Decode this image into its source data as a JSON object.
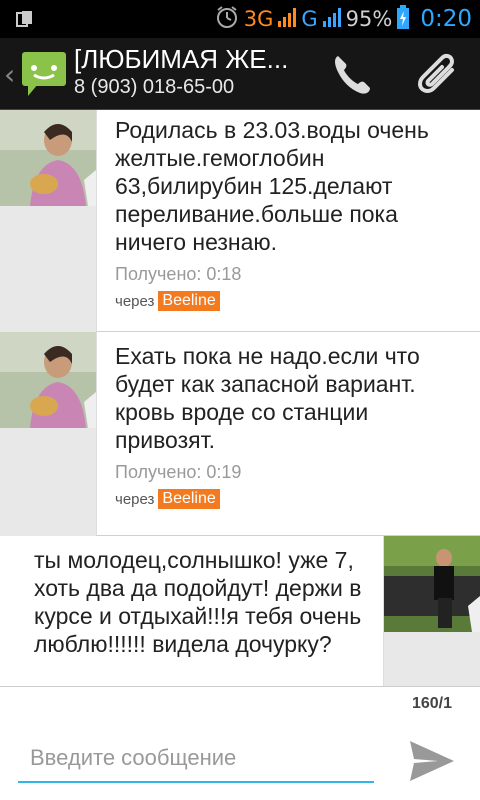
{
  "status_bar": {
    "network_3g": "3G",
    "network_g": "G",
    "battery_pct": "95%",
    "time": "0:20"
  },
  "action_bar": {
    "title": "[ЛЮБИМАЯ ЖЕ...",
    "subtitle": "8 (903) 018-65-00"
  },
  "messages": [
    {
      "direction": "incoming",
      "text": "Родилась в 23.03.воды очень желтые.гемоглобин 63,билирубин 125.делают переливание.больше пока ничего незнаю.",
      "status": "Получено: 0:18",
      "via_label": "через",
      "operator": "Beeline"
    },
    {
      "direction": "incoming",
      "text": "Ехать пока не надо.если что будет как запасной вариант. кровь вроде со станции привозят.",
      "status": "Получено: 0:19",
      "via_label": "через",
      "operator": "Beeline"
    },
    {
      "direction": "outgoing",
      "text": "ты молодец,солнышко! уже 7, хоть два да подойдут! держи в курсе и отдыхай!!!я тебя очень люблю!!!!!! видела дочурку?"
    }
  ],
  "compose": {
    "counter": "160/1",
    "placeholder": "Введите сообщение",
    "value": ""
  },
  "icons": {
    "app": "sms-app-icon",
    "call": "phone-icon",
    "attach": "paperclip-icon",
    "send": "send-icon"
  },
  "colors": {
    "accent": "#33b5e5",
    "operator_badge": "#f47a1f",
    "app_icon": "#8bc34a"
  }
}
